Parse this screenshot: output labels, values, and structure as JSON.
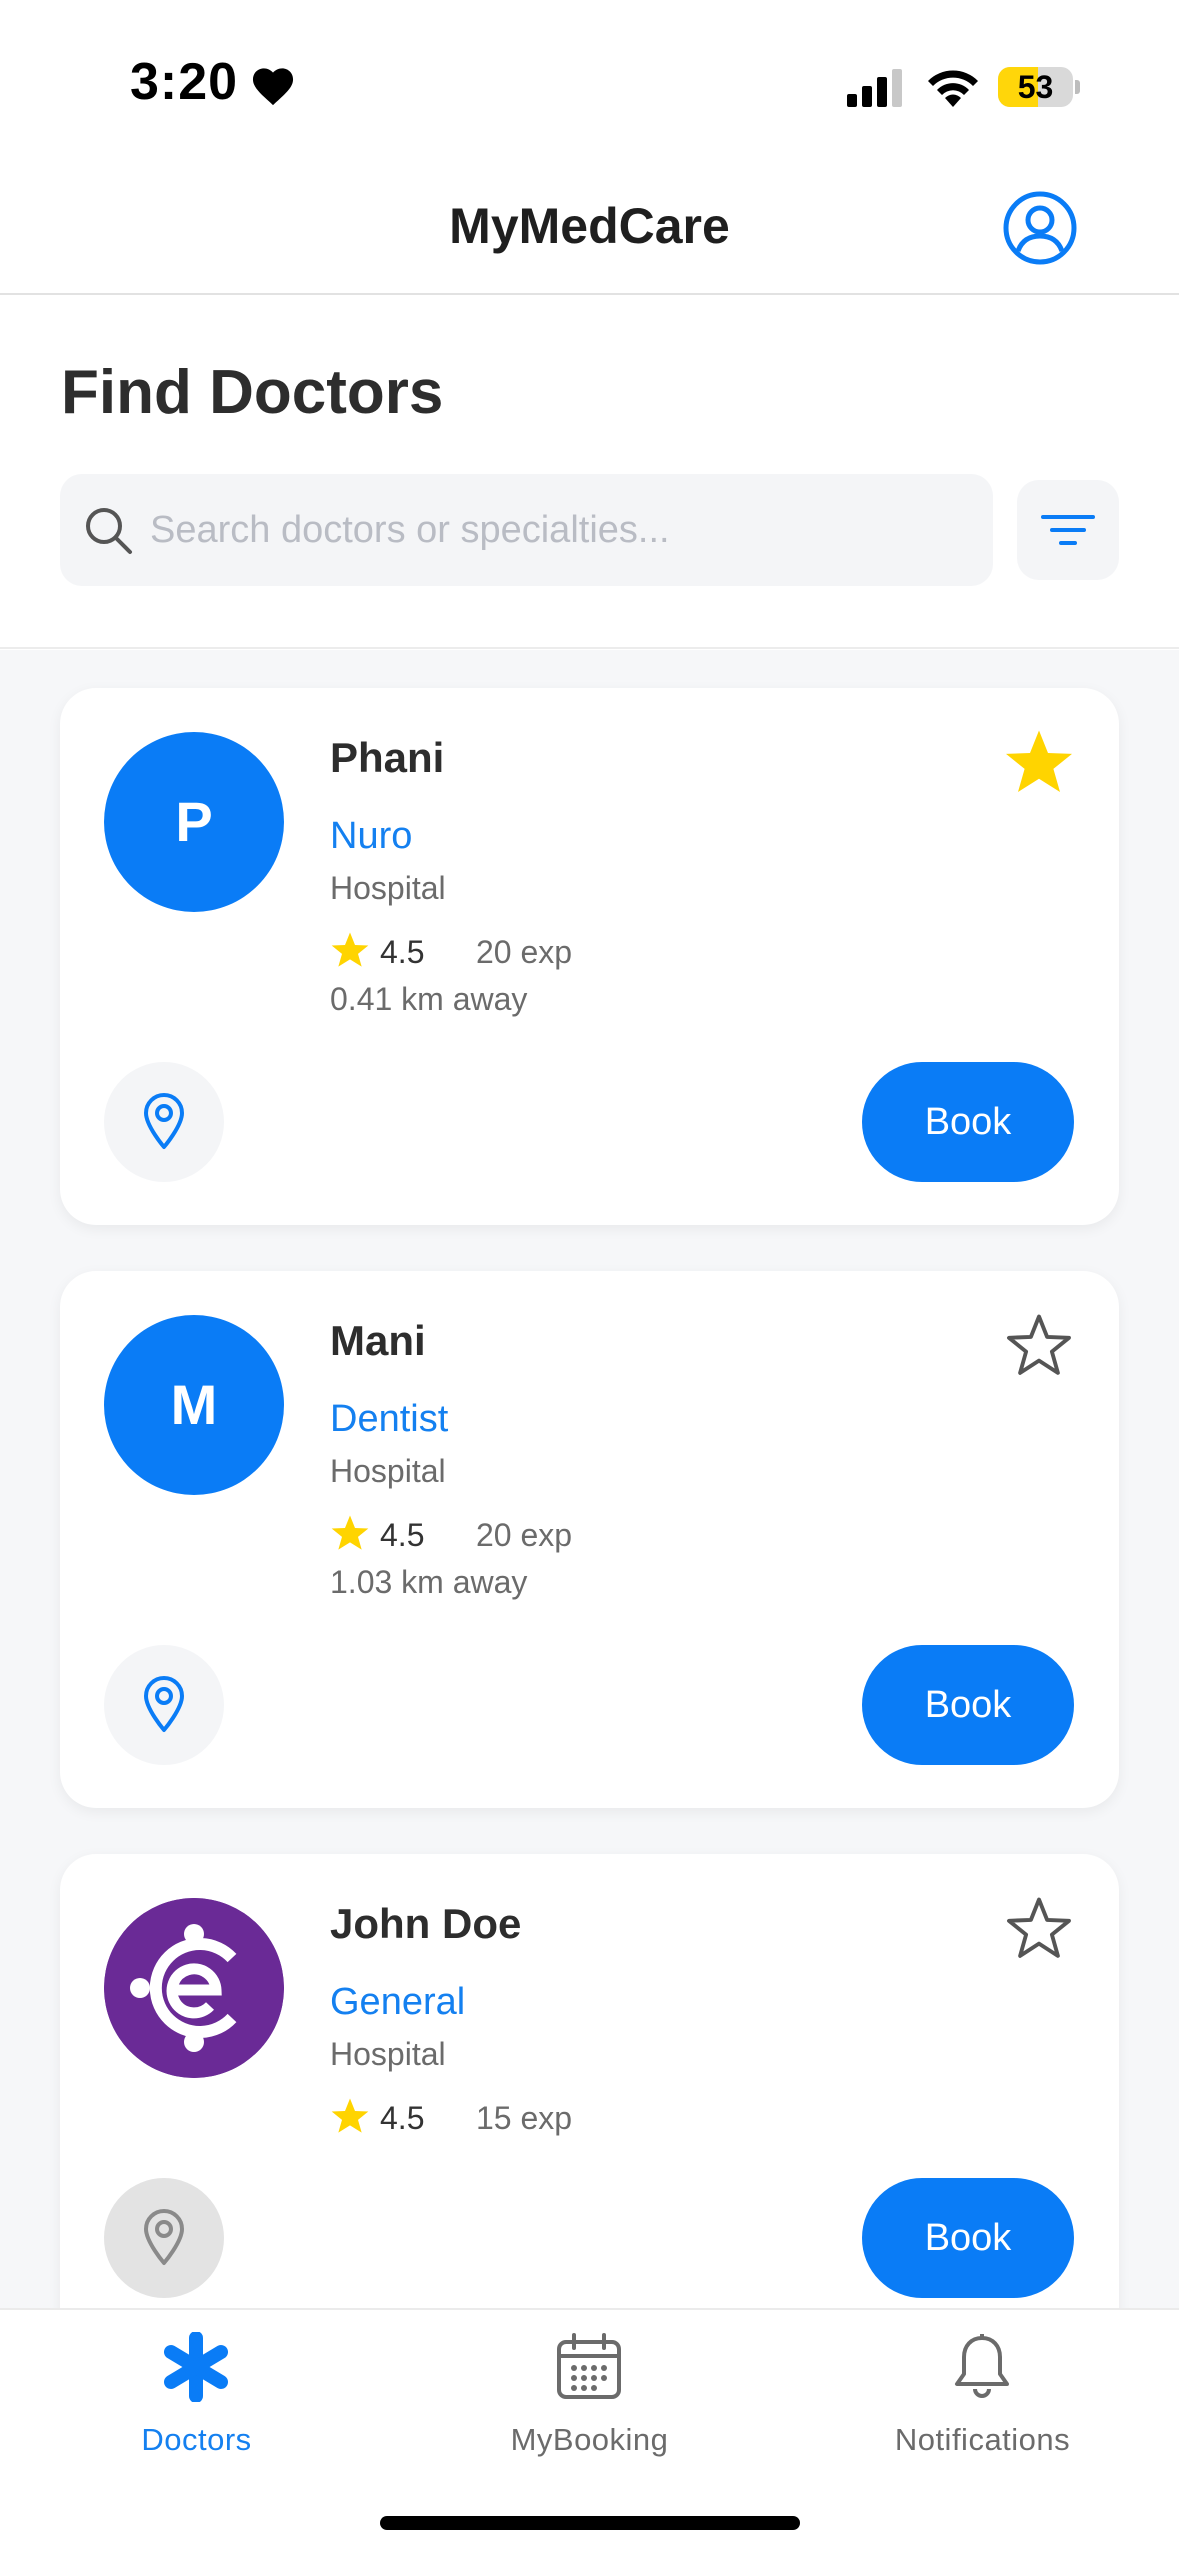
{
  "status_bar": {
    "time": "3:20",
    "battery": "53",
    "battery_level": 0.53,
    "icons": [
      "heart-icon",
      "signal-icon",
      "wifi-icon",
      "battery-icon"
    ]
  },
  "header": {
    "title": "MyMedCare",
    "profile_icon": "user-circle-icon"
  },
  "search": {
    "page_title": "Find Doctors",
    "placeholder": "Search doctors or specialties...",
    "value": "",
    "filter_icon": "filter-icon"
  },
  "doctors": [
    {
      "initial": "P",
      "name": "Phani",
      "specialty": "Nuro",
      "place": "Hospital",
      "rating": "4.5",
      "experience": "20 exp",
      "distance": "0.41 km away",
      "favorite": true,
      "book_label": "Book"
    },
    {
      "initial": "M",
      "name": "Mani",
      "specialty": "Dentist",
      "place": "Hospital",
      "rating": "4.5",
      "experience": "20 exp",
      "distance": "1.03 km away",
      "favorite": false,
      "book_label": "Book"
    },
    {
      "initial": "",
      "name": "John Doe",
      "specialty": "General",
      "place": "Hospital",
      "rating": "4.5",
      "experience": "15 exp",
      "distance": "",
      "favorite": false,
      "book_label": "Book"
    }
  ],
  "tabs": [
    {
      "label": "Doctors",
      "icon": "asterisk-icon",
      "active": true
    },
    {
      "label": "MyBooking",
      "icon": "calendar-icon",
      "active": false
    },
    {
      "label": "Notifications",
      "icon": "bell-icon",
      "active": false
    }
  ],
  "colors": {
    "accent": "#0a7cf6",
    "link": "#1480f0",
    "star": "#ffd400",
    "logo_bg": "#6a2a96"
  }
}
